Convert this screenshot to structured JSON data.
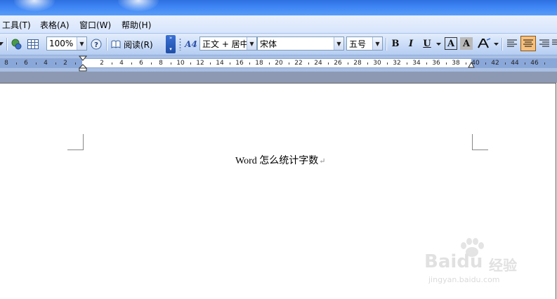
{
  "menu": {
    "items": [
      {
        "label": "工具(T)"
      },
      {
        "label": "表格(A)"
      },
      {
        "label": "窗口(W)"
      },
      {
        "label": "帮助(H)"
      }
    ]
  },
  "toolbar": {
    "zoom_value": "100%",
    "read_label": "阅读(R)",
    "style_value": "正文 + 居中",
    "font_value": "宋体",
    "size_value": "五号",
    "bold_label": "B",
    "italic_label": "I",
    "underline_label": "U",
    "char_border_label": "A",
    "char_shading_label": "A",
    "style_icon_label": "A4"
  },
  "ruler": {
    "labels": [
      "8",
      "6",
      "4",
      "2",
      "2",
      "4",
      "6",
      "8",
      "10",
      "12",
      "14",
      "16",
      "18",
      "20",
      "22",
      "24",
      "26",
      "28",
      "30",
      "32",
      "34",
      "36",
      "38",
      "40",
      "42",
      "44",
      "46"
    ]
  },
  "document": {
    "text": "Word 怎么统计字数",
    "para_mark": "↵"
  },
  "watermark": {
    "brand": "Baidu",
    "brand_cn": "经验",
    "url": "jingyan.baidu.com"
  },
  "colors": {
    "title_blue": "#3f86f5",
    "toolbar_blue": "#c7daf7",
    "active_orange": "#f7c07c",
    "ruler_blue": "#8aa7d9"
  }
}
